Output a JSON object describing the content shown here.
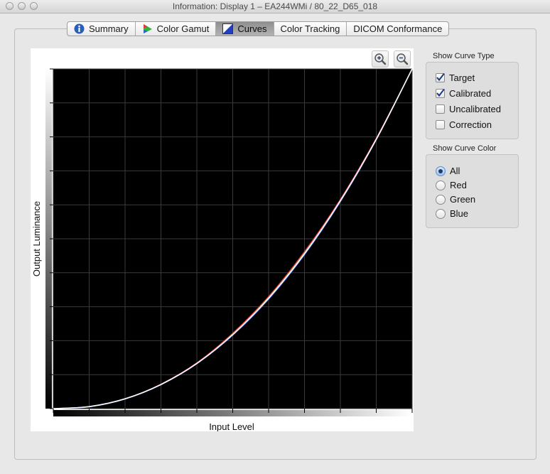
{
  "window": {
    "title": "Information: Display 1 – EA244WMi / 80_22_D65_018"
  },
  "tabs": [
    {
      "label": "Summary",
      "icon": "info-icon",
      "selected": false
    },
    {
      "label": "Color Gamut",
      "icon": "color-gamut-icon",
      "selected": false
    },
    {
      "label": "Curves",
      "icon": "curves-icon",
      "selected": true
    },
    {
      "label": "Color Tracking",
      "icon": "",
      "selected": false
    },
    {
      "label": "DICOM Conformance",
      "icon": "",
      "selected": false
    }
  ],
  "chart": {
    "zoom_in_icon": "zoom-in-icon",
    "zoom_out_icon": "zoom-out-icon"
  },
  "chart_data": {
    "type": "line",
    "xlabel": "Input Level",
    "ylabel": "Output Luminance",
    "xlim": [
      0,
      1
    ],
    "ylim": [
      0,
      1
    ],
    "grid": true,
    "x": [
      0,
      0.1,
      0.2,
      0.3,
      0.4,
      0.5,
      0.6,
      0.7,
      0.8,
      0.9,
      1.0
    ],
    "series": [
      {
        "values": [
          0,
          0.006,
          0.029,
          0.071,
          0.133,
          0.218,
          0.325,
          0.456,
          0.612,
          0.793,
          1.0
        ],
        "color": "#ffffff"
      },
      {
        "values": [
          0,
          0.006,
          0.029,
          0.072,
          0.135,
          0.222,
          0.33,
          0.462,
          0.616,
          0.796,
          1.0
        ],
        "color": "#ff3c3c"
      },
      {
        "values": [
          0,
          0.006,
          0.029,
          0.071,
          0.134,
          0.219,
          0.327,
          0.458,
          0.614,
          0.795,
          1.0
        ],
        "color": "#3cff3c"
      },
      {
        "values": [
          0,
          0.005,
          0.028,
          0.07,
          0.132,
          0.216,
          0.322,
          0.453,
          0.609,
          0.791,
          1.0
        ],
        "color": "#5a8cff"
      }
    ]
  },
  "curve_type": {
    "label": "Show Curve Type",
    "options": [
      {
        "label": "Target",
        "checked": true
      },
      {
        "label": "Calibrated",
        "checked": true
      },
      {
        "label": "Uncalibrated",
        "checked": false
      },
      {
        "label": "Correction",
        "checked": false
      }
    ]
  },
  "curve_color": {
    "label": "Show Curve Color",
    "options": [
      {
        "label": "All",
        "selected": true
      },
      {
        "label": "Red",
        "selected": false
      },
      {
        "label": "Green",
        "selected": false
      },
      {
        "label": "Blue",
        "selected": false
      }
    ]
  }
}
